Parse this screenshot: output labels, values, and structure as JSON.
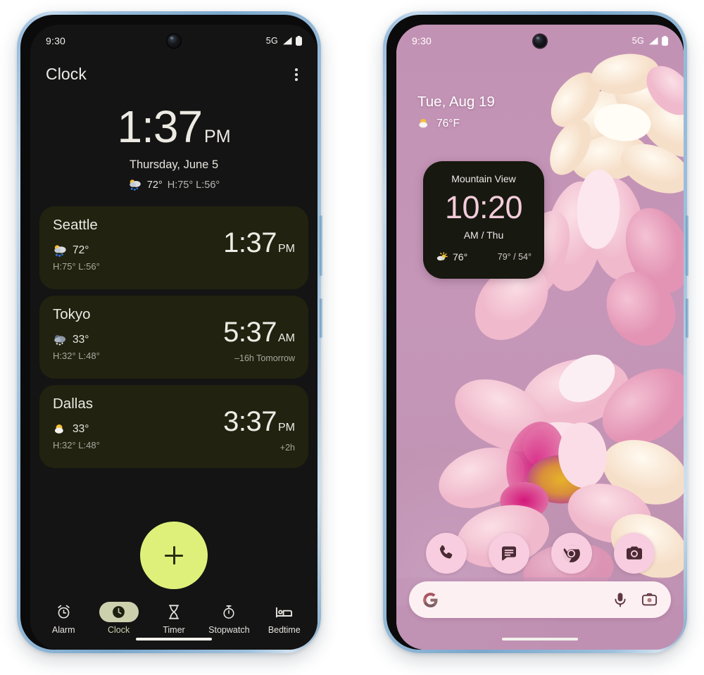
{
  "colors": {
    "frame": "#8fb6d8",
    "clock_bg": "#141414",
    "card_bg": "#21220f",
    "fab": "#dff07a",
    "nav_active_pill": "#cdd0ad",
    "widget_bg": "#17180f",
    "widget_time": "#f2ccda",
    "wallpaper": "#c193b6",
    "dock_icon": "#f7cddf",
    "search_bg": "#fdf0f3"
  },
  "left_phone": {
    "status_bar": {
      "time": "9:30",
      "network": "5G",
      "signal_icon": "signal-bars-icon",
      "battery_icon": "battery-full-icon"
    },
    "app_bar": {
      "title": "Clock",
      "overflow_icon": "overflow-menu-icon"
    },
    "main_clock": {
      "time": "1:37",
      "ampm": "PM",
      "date": "Thursday, June 5",
      "weather_icon": "rain-sun-cloud-icon",
      "temp": "72°",
      "high_low": "H:75° L:56°"
    },
    "city_cards": [
      {
        "name": "Seattle",
        "weather_icon": "rain-sun-cloud-icon",
        "temp": "72°",
        "high_low": "H:75° L:56°",
        "time": "1:37",
        "ampm": "PM",
        "offset": ""
      },
      {
        "name": "Tokyo",
        "weather_icon": "snow-cloud-night-icon",
        "temp": "33°",
        "high_low": "H:32° L:48°",
        "time": "5:37",
        "ampm": "AM",
        "offset": "–16h  Tomorrow"
      },
      {
        "name": "Dallas",
        "weather_icon": "partly-cloudy-icon",
        "temp": "33°",
        "high_low": "H:32° L:48°",
        "time": "3:37",
        "ampm": "PM",
        "offset": "+2h"
      }
    ],
    "fab": {
      "label": "+",
      "name": "add-city-button"
    },
    "nav_items": [
      {
        "label": "Alarm",
        "icon": "alarm-clock-icon",
        "active": false
      },
      {
        "label": "Clock",
        "icon": "clock-icon",
        "active": true
      },
      {
        "label": "Timer",
        "icon": "hourglass-timer-icon",
        "active": false
      },
      {
        "label": "Stopwatch",
        "icon": "stopwatch-icon",
        "active": false
      },
      {
        "label": "Bedtime",
        "icon": "bed-icon",
        "active": false
      }
    ]
  },
  "right_phone": {
    "status_bar": {
      "time": "9:30",
      "network": "5G",
      "signal_icon": "signal-bars-icon",
      "battery_icon": "battery-full-icon"
    },
    "home_info": {
      "date": "Tue, Aug 19",
      "weather_icon": "partly-cloudy-icon",
      "temp": "76°F"
    },
    "widget": {
      "city": "Mountain View",
      "time": "10:20",
      "sub": "AM / Thu",
      "weather_icon": "sun-cloud-icon",
      "temp": "76°",
      "high_low": "79° / 54°"
    },
    "dock": [
      {
        "name": "phone-icon",
        "label": "Phone"
      },
      {
        "name": "messages-icon",
        "label": "Messages"
      },
      {
        "name": "chrome-icon",
        "label": "Chrome"
      },
      {
        "name": "camera-icon",
        "label": "Camera"
      }
    ],
    "search": {
      "google_icon": "google-g-icon",
      "mic_icon": "microphone-icon",
      "lens_icon": "google-lens-camera-icon",
      "placeholder": ""
    }
  }
}
